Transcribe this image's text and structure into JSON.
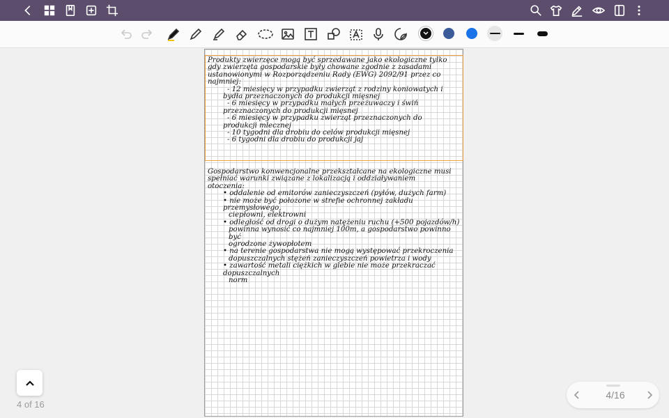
{
  "appbar": {
    "left_icons": [
      "back-icon",
      "grid-icon",
      "bookmark-icon",
      "add-page-icon",
      "crop-icon"
    ],
    "right_icons": [
      "search-icon",
      "shirt-icon",
      "pen-edit-icon",
      "eye-icon",
      "sidebar-toggle-icon",
      "more-icon"
    ]
  },
  "toolbar": {
    "tools": [
      "undo-icon",
      "redo-icon",
      "pen-icon",
      "fineliner-icon",
      "highlighter-icon",
      "eraser-icon",
      "lasso-icon",
      "image-icon",
      "text-box-icon",
      "shape-icon",
      "text-recognition-icon",
      "microphone-icon",
      "sticker-icon"
    ],
    "colors": [
      "#111111",
      "#3a5a9a",
      "#1a73e8"
    ],
    "selected_color": "#111111"
  },
  "note": {
    "para1": [
      "Produkty zwierzęce mogą być sprzedawane jako ekologiczne tylko",
      "gdy zwierzęta gospodarskie były chowane zgodnie z zasadami",
      "ustanowionymi w Rozporządzeniu Rady (EWG) 2092/91 przez co",
      "najmniej:"
    ],
    "list1": [
      "- 12 miesięcy w przypadku zwierząt z rodziny koniowatych i",
      "bydła przeznaczonych do produkcji mięsnej",
      "- 6 miesięcy w przypadku małych przeżuwaczy i świń",
      "przeznaczonych do produkcji mięsnej",
      "- 6 miesięcy w przypadku zwierząt przeznaczonych do",
      "produkcji mlecznej",
      "- 10 tygodni dla drobiu do celów produkcji mięsnej",
      "- 6 tygodni dla drobiu do produkcji jaj"
    ],
    "para2": [
      "Gospodarstwo konwencjonalne przekształcane na ekologiczne musi",
      "spełniać warunki związane z lokalizacją i oddziaływaniem",
      "otoczenia:"
    ],
    "list2": [
      "• oddalenie od emitorów zanieczyszczeń (pyłów, dużych farm)",
      "• nie może być położone w strefie ochronnej zakładu przemysłowego,",
      "ciepłowni, elektrowni",
      "• odległość od drogi o dużym natężeniu ruchu (+500 pojazdów/h)",
      "powinna wynosić co najmniej 100m, a gospodarstwo powinno być",
      "ogrodzone żywopłotem",
      "• na terenie gospodarstwa nie mogą występować przekroczenia",
      "dopuszczalnych stężeń zanieczyszczeń powietrza i wody",
      "• zawartość metali ciężkich w glebie nie może przekraczać dopuszczalnych",
      "norm"
    ]
  },
  "footer": {
    "page_count": "4 of 16",
    "pager_label": "4/16"
  }
}
